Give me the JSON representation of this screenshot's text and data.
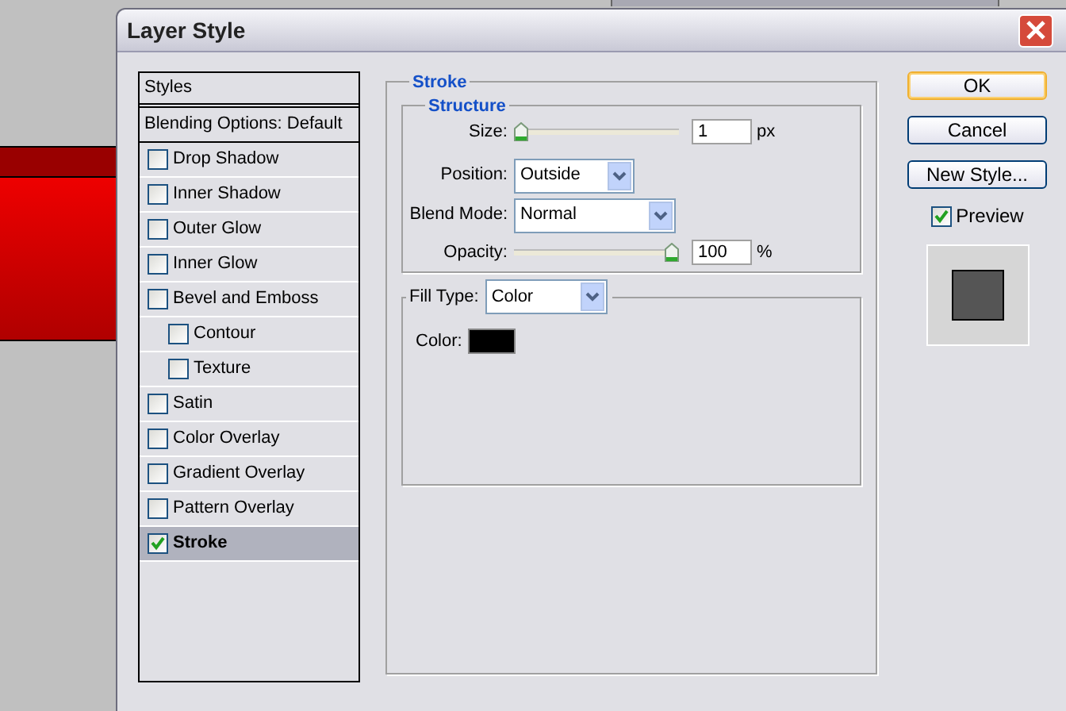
{
  "window": {
    "title": "Layer Style"
  },
  "styles_list": {
    "header": "Styles",
    "blending_options": "Blending Options: Default",
    "items": [
      {
        "label": "Drop Shadow",
        "checked": false,
        "selected": false
      },
      {
        "label": "Inner Shadow",
        "checked": false,
        "selected": false
      },
      {
        "label": "Outer Glow",
        "checked": false,
        "selected": false
      },
      {
        "label": "Inner Glow",
        "checked": false,
        "selected": false
      },
      {
        "label": "Bevel and Emboss",
        "checked": false,
        "selected": false,
        "children": [
          {
            "label": "Contour",
            "checked": false,
            "selected": false
          },
          {
            "label": "Texture",
            "checked": false,
            "selected": false
          }
        ]
      },
      {
        "label": "Satin",
        "checked": false,
        "selected": false
      },
      {
        "label": "Color Overlay",
        "checked": false,
        "selected": false
      },
      {
        "label": "Gradient Overlay",
        "checked": false,
        "selected": false
      },
      {
        "label": "Pattern Overlay",
        "checked": false,
        "selected": false
      },
      {
        "label": "Stroke",
        "checked": true,
        "selected": true
      }
    ]
  },
  "stroke_panel": {
    "title": "Stroke",
    "structure": {
      "title": "Structure",
      "size": {
        "label": "Size:",
        "level": 0,
        "value": "1",
        "unit": "px"
      },
      "position": {
        "label": "Position:",
        "value": "Outside"
      },
      "blend_mode": {
        "label": "Blend Mode:",
        "value": "Normal"
      },
      "opacity": {
        "label": "Opacity:",
        "level": 1,
        "value": "100",
        "unit": "%"
      }
    },
    "fill_type": {
      "label": "Fill Type:",
      "value": "Color"
    },
    "color": {
      "label": "Color:",
      "color": "#000000"
    }
  },
  "buttons": [
    {
      "label": "OK",
      "default": true
    },
    {
      "label": "Cancel",
      "default": false
    },
    {
      "label": "New Style...",
      "default": false
    }
  ],
  "preview": {
    "label": "Preview",
    "checked": true
  }
}
